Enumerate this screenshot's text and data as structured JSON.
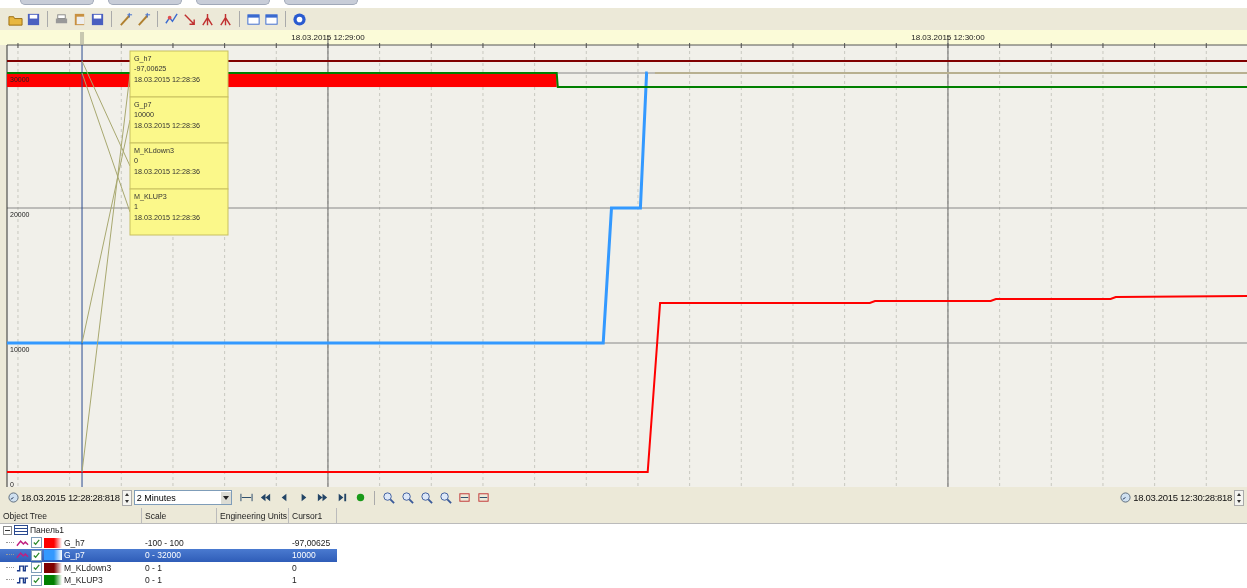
{
  "time_labels": [
    "18.03.2015 12:29:00",
    "18.03.2015 12:30:00"
  ],
  "value_labels": [
    "30000",
    "20000",
    "10000",
    "0"
  ],
  "cursor_tooltips": [
    {
      "name": "G_h7",
      "value": "-97,00625",
      "time": "18.03.2015 12:28:36"
    },
    {
      "name": "G_p7",
      "value": "10000",
      "time": "18.03.2015 12:28:36"
    },
    {
      "name": "M_KLdown3",
      "value": "0",
      "time": "18.03.2015 12:28:36"
    },
    {
      "name": "M_KLUP3",
      "value": "1",
      "time": "18.03.2015 12:28:36"
    }
  ],
  "navigator": {
    "start_time": "18.03.2015 12:28:28:818",
    "range": "2 Minutes",
    "end_time": "18.03.2015 12:30:28:818"
  },
  "object_tree": {
    "columns": [
      "Object Tree",
      "Scale",
      "Engineering Units",
      "Cursor1"
    ],
    "root": {
      "label": "Панель1",
      "expanded": true,
      "children": [
        {
          "name": "G_h7",
          "kind": "analog",
          "checked": true,
          "color": "#ff0000",
          "scale": "-100 - 100",
          "cursor": "-97,00625",
          "selected": false
        },
        {
          "name": "G_p7",
          "kind": "analog",
          "checked": true,
          "color": "#3399ff",
          "scale": "0 - 32000",
          "cursor": "10000",
          "selected": true
        },
        {
          "name": "M_KLdown3",
          "kind": "digital",
          "checked": true,
          "color": "#800000",
          "scale": "0 - 1",
          "cursor": "0",
          "selected": false
        },
        {
          "name": "M_KLUP3",
          "kind": "digital",
          "checked": true,
          "color": "#008000",
          "scale": "0 - 1",
          "cursor": "1",
          "selected": false
        }
      ]
    }
  }
}
